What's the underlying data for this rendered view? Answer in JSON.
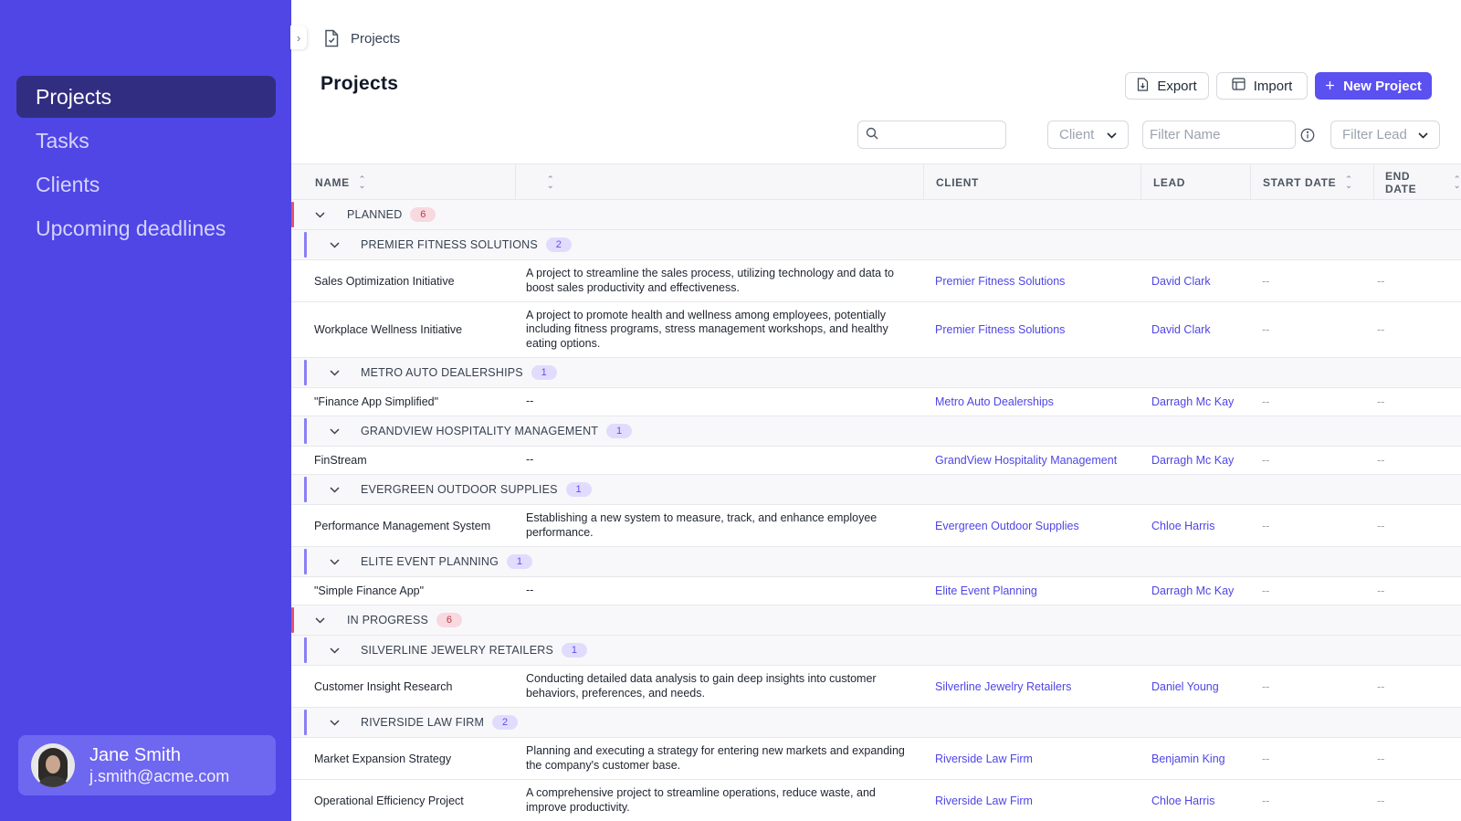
{
  "sidebar": {
    "nav": [
      {
        "label": "Projects",
        "active": true
      },
      {
        "label": "Tasks",
        "active": false
      },
      {
        "label": "Clients",
        "active": false
      },
      {
        "label": "Upcoming deadlines",
        "active": false
      }
    ],
    "user": {
      "name": "Jane Smith",
      "email": "j.smith@acme.com"
    }
  },
  "breadcrumb": {
    "label": "Projects"
  },
  "page": {
    "title": "Projects"
  },
  "toolbar": {
    "export_label": "Export",
    "import_label": "Import",
    "new_label": "New Project"
  },
  "filters": {
    "search_placeholder": "",
    "client_label": "Client",
    "name_placeholder": "Filter Name",
    "lead_label": "Filter Lead"
  },
  "table": {
    "headers": {
      "name": "NAME",
      "description": "",
      "client": "CLIENT",
      "lead": "LEAD",
      "start": "START DATE",
      "end": "END DATE"
    },
    "rows": [
      {
        "type": "status",
        "label": "PLANNED",
        "count": "6"
      },
      {
        "type": "client",
        "label": "PREMIER FITNESS SOLUTIONS",
        "count": "2"
      },
      {
        "type": "project",
        "name": "Sales Optimization Initiative",
        "desc": "A project to streamline the sales process, utilizing technology and data to boost sales productivity and effectiveness.",
        "client": "Premier Fitness Solutions",
        "lead": "David Clark",
        "start": "--",
        "end": "--"
      },
      {
        "type": "project",
        "name": "Workplace Wellness Initiative",
        "desc": "A project to promote health and wellness among employees, potentially including fitness programs, stress management workshops, and healthy eating options.",
        "client": "Premier Fitness Solutions",
        "lead": "David Clark",
        "start": "--",
        "end": "--"
      },
      {
        "type": "client",
        "label": "METRO AUTO DEALERSHIPS",
        "count": "1"
      },
      {
        "type": "project",
        "name": "\"Finance App Simplified\"",
        "desc": "--",
        "client": "Metro Auto Dealerships",
        "lead": "Darragh Mc Kay",
        "start": "--",
        "end": "--"
      },
      {
        "type": "client",
        "label": "GRANDVIEW HOSPITALITY MANAGEMENT",
        "count": "1"
      },
      {
        "type": "project",
        "name": "FinStream",
        "desc": "--",
        "client": "GrandView Hospitality Management",
        "lead": "Darragh Mc Kay",
        "start": "--",
        "end": "--"
      },
      {
        "type": "client",
        "label": "EVERGREEN OUTDOOR SUPPLIES",
        "count": "1"
      },
      {
        "type": "project",
        "name": "Performance Management System",
        "desc": "Establishing a new system to measure, track, and enhance employee performance.",
        "client": "Evergreen Outdoor Supplies",
        "lead": "Chloe Harris",
        "start": "--",
        "end": "--"
      },
      {
        "type": "client",
        "label": "ELITE EVENT PLANNING",
        "count": "1"
      },
      {
        "type": "project",
        "name": "\"Simple Finance App\"",
        "desc": "--",
        "client": "Elite Event Planning",
        "lead": "Darragh Mc Kay",
        "start": "--",
        "end": "--"
      },
      {
        "type": "status",
        "label": "IN PROGRESS",
        "count": "6"
      },
      {
        "type": "client",
        "label": "SILVERLINE JEWELRY RETAILERS",
        "count": "1"
      },
      {
        "type": "project",
        "name": "Customer Insight Research",
        "desc": "Conducting detailed data analysis to gain deep insights into customer behaviors, preferences, and needs.",
        "client": "Silverline Jewelry Retailers",
        "lead": "Daniel Young",
        "start": "--",
        "end": "--"
      },
      {
        "type": "client",
        "label": "RIVERSIDE LAW FIRM",
        "count": "2"
      },
      {
        "type": "project",
        "name": "Market Expansion Strategy",
        "desc": "Planning and executing a strategy for entering new markets and expanding the company's customer base.",
        "client": "Riverside Law Firm",
        "lead": "Benjamin King",
        "start": "--",
        "end": "--"
      },
      {
        "type": "project",
        "name": "Operational Efficiency Project",
        "desc": "A comprehensive project to streamline operations, reduce waste, and improve productivity.",
        "client": "Riverside Law Firm",
        "lead": "Chloe Harris",
        "start": "--",
        "end": "--"
      }
    ]
  },
  "colors": {
    "sidebar": "#4f46e5",
    "nav_active": "#312e81",
    "accent": "#5b50f0",
    "status_bar": "#e05270",
    "client_bar": "#8b7ff5"
  },
  "icons": {
    "breadcrumb": "document-check-icon",
    "search": "search-icon",
    "info": "info-icon",
    "export": "file-export-icon",
    "import": "table-import-icon",
    "new": "plus-icon"
  }
}
